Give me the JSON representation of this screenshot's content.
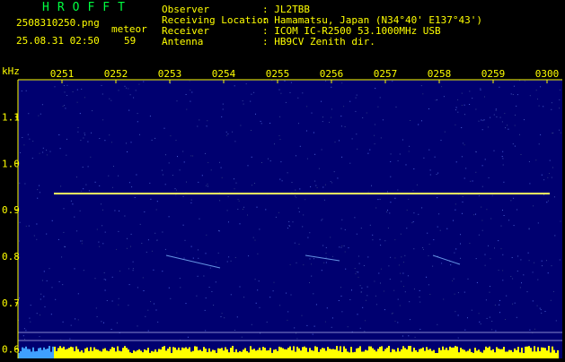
{
  "header": {
    "brand": "HROFFT",
    "filename": "2508310250.png",
    "datetime": "25.08.31 02:50",
    "count_label": "meteor",
    "count_value": "59",
    "fields": [
      {
        "label": "Observer",
        "value": ": JL2TBB"
      },
      {
        "label": "Receiving Location",
        "value": ": Hamamatsu, Japan (N34°40' E137°43')"
      },
      {
        "label": "Receiver",
        "value": ": ICOM IC-R2500 53.1000MHz USB"
      },
      {
        "label": "Antenna",
        "value": ": HB9CV Zenith dir."
      }
    ]
  },
  "chart_data": {
    "type": "heatmap",
    "ylabel": "kHz",
    "x_ticks": [
      "0251",
      "0252",
      "0253",
      "0254",
      "0255",
      "0256",
      "0257",
      "0258",
      "0259",
      "0300"
    ],
    "y_ticks": [
      "1.1",
      "1.0",
      "0.9",
      "0.8",
      "0.7",
      "0.6"
    ],
    "ylim": [
      0.58,
      1.18
    ],
    "carrier_khz": 0.935,
    "colors": {
      "background": "#000070",
      "text": "#ffff00",
      "carrier": "#ffff60",
      "noise_band": "#ffff00"
    }
  }
}
